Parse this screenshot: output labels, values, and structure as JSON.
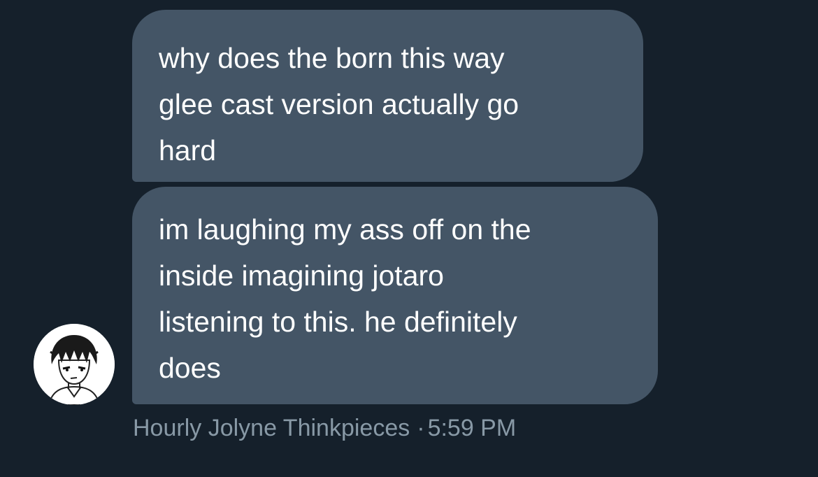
{
  "conversation": {
    "messages": [
      {
        "lines": [
          "why does the born this way",
          "glee cast version actually go",
          "hard"
        ]
      },
      {
        "lines": [
          "im laughing my ass off on the",
          "inside imagining jotaro",
          "listening to this. he definitely",
          "does"
        ]
      }
    ],
    "sender": {
      "name": "Hourly Jolyne Thinkpieces",
      "separator": "·",
      "time": "5:59 PM",
      "avatar_icon": "manga-character-avatar"
    }
  },
  "colors": {
    "background": "#15202b",
    "bubble": "#445566",
    "text": "#ffffff",
    "meta_text": "#8899a6"
  }
}
